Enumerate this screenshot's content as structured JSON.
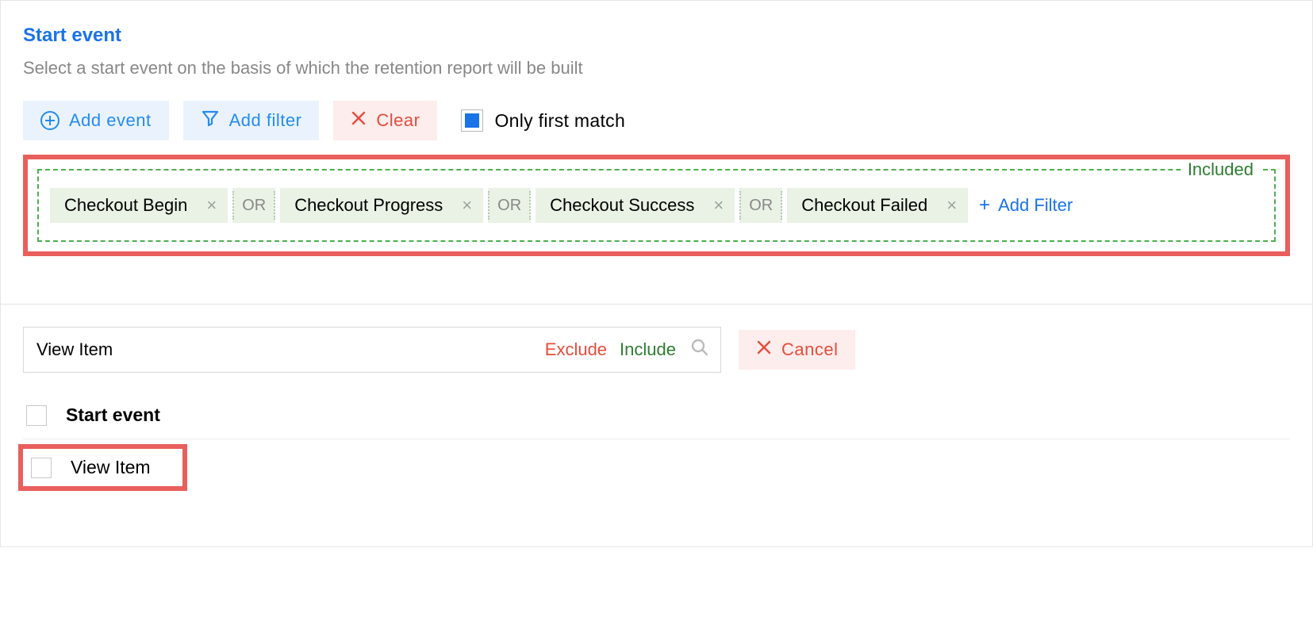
{
  "header": {
    "title": "Start event",
    "subtitle": "Select a start event on the basis of which the retention report will be built"
  },
  "toolbar": {
    "add_event": "Add event",
    "add_filter": "Add filter",
    "clear": "Clear",
    "only_first_match": "Only first match"
  },
  "included": {
    "legend": "Included",
    "or": "OR",
    "add_filter": "Add Filter",
    "chips": [
      "Checkout Begin",
      "Checkout Progress",
      "Checkout Success",
      "Checkout Failed"
    ]
  },
  "search": {
    "value": "View Item",
    "exclude": "Exclude",
    "include": "Include",
    "cancel": "Cancel"
  },
  "list": {
    "header": "Start event",
    "item": "View Item"
  }
}
